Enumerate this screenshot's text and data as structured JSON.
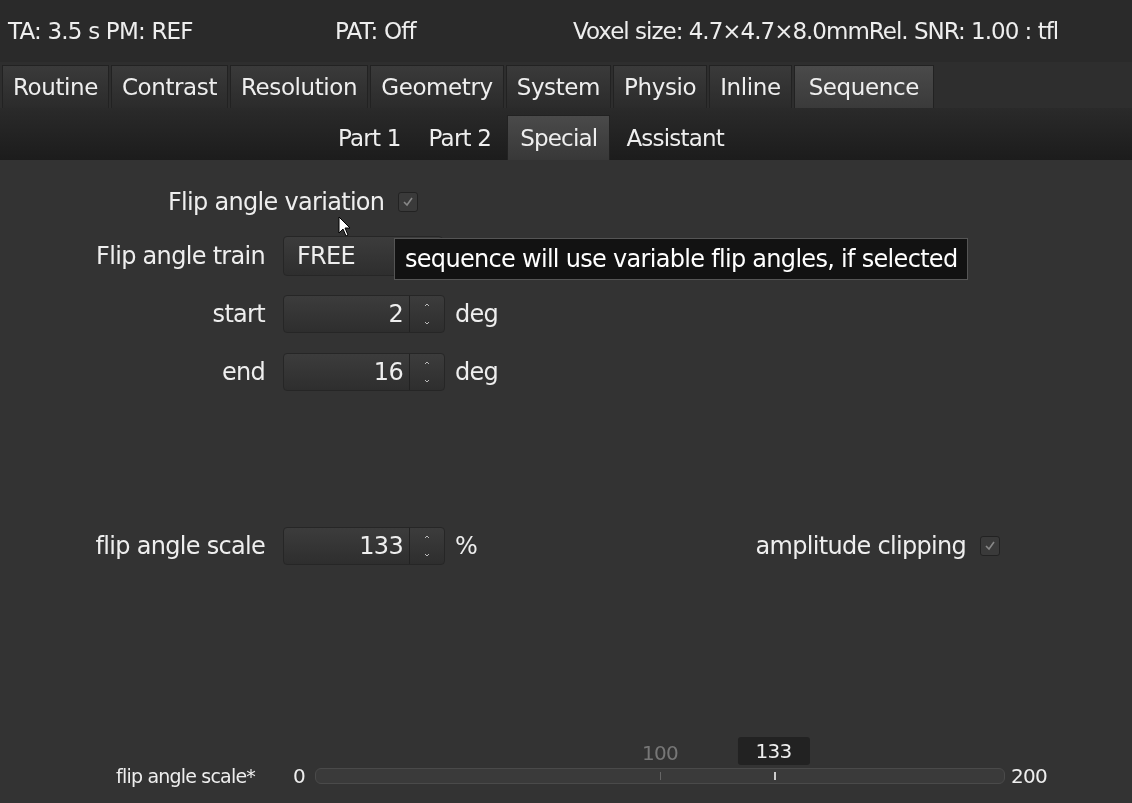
{
  "header": {
    "items": [
      "TA: 3.5 s  PM: REF",
      "PAT: Off",
      "Voxel size: 4.7×4.7×8.0mmRel. SNR: 1.00 : tfl"
    ]
  },
  "tabs": [
    {
      "label": "Routine",
      "selected": false
    },
    {
      "label": "Contrast",
      "selected": false
    },
    {
      "label": "Resolution",
      "selected": false
    },
    {
      "label": "Geometry",
      "selected": false
    },
    {
      "label": "System",
      "selected": false
    },
    {
      "label": "Physio",
      "selected": false
    },
    {
      "label": "Inline",
      "selected": false
    },
    {
      "label": "Sequence",
      "selected": true
    }
  ],
  "subtabs": [
    {
      "label": "Part 1",
      "selected": false
    },
    {
      "label": "Part 2",
      "selected": false
    },
    {
      "label": "Special",
      "selected": true
    },
    {
      "label": "Assistant",
      "selected": false
    }
  ],
  "flip_angle_variation": {
    "label": "Flip angle variation",
    "checked": true,
    "disabled": true
  },
  "flip_angle_train": {
    "label": "Flip angle train",
    "value": "FREE"
  },
  "tooltip": {
    "text": "sequence will use variable flip angles, if selected"
  },
  "start": {
    "label": "start",
    "value": "2",
    "unit": "deg"
  },
  "end": {
    "label": "end",
    "value": "16",
    "unit": "deg"
  },
  "flip_angle_scale": {
    "label": "flip angle scale",
    "value": "133",
    "unit": "%"
  },
  "amplitude_clipping": {
    "label": "amplitude clipping",
    "checked": true,
    "disabled": true
  },
  "slider": {
    "label": "flip angle scale*",
    "min_label": "0",
    "max_label": "200",
    "default_label": "100",
    "value_label": "133",
    "level": 0.665
  }
}
